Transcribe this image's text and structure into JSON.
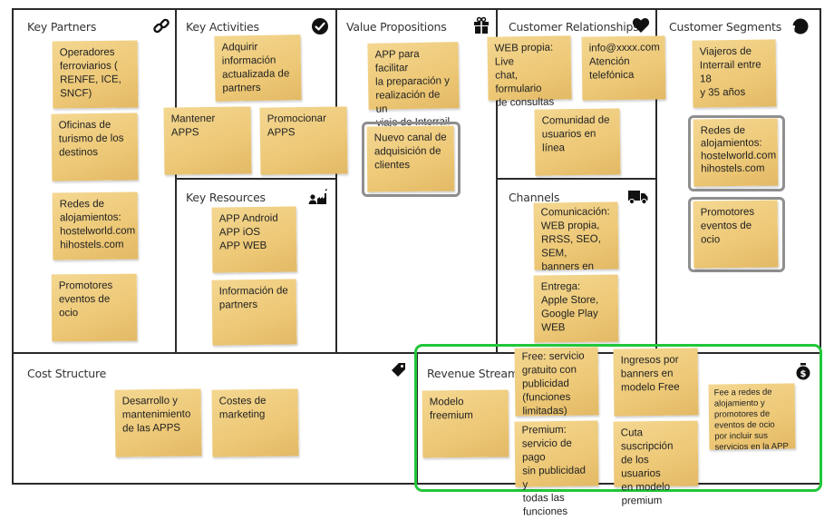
{
  "canvas": {
    "key_partners": {
      "title": "Key Partners",
      "icon": "link-icon",
      "notes": [
        "Operadores\nferroviarios (\nRENFE, ICE,\nSNCF)",
        "Oficinas de\nturismo de los\ndestinos",
        "Redes de\nalojamientos:\nhostelworld.com\nhihostels.com",
        "Promotores\neventos de ocio"
      ]
    },
    "key_activities": {
      "title": "Key Activities",
      "icon": "checkmark-circle-icon",
      "notes": [
        "Adquirir\ninformación\nactualizada de\npartners",
        "Mantener APPS",
        "Promocionar\nAPPS"
      ]
    },
    "key_resources": {
      "title": "Key Resources",
      "icon": "factory-worker-icon",
      "notes": [
        "APP Android\nAPP iOS\nAPP WEB",
        "Información de\npartners"
      ]
    },
    "value_propositions": {
      "title": "Value Propositions",
      "icon": "gift-icon",
      "notes": [
        "APP para facilitar\nla preparación y\nrealización de un\nviaje de Interrail",
        "Nuevo canal de\nadquisición de\nclientes"
      ]
    },
    "customer_relationships": {
      "title": "Customer Relationships",
      "icon": "heart-icon",
      "notes": [
        "WEB propia: Live\nchat, formulario\nde consultas",
        "info@xxxx.com\nAtención\ntelefónica",
        "Comunidad de\nusuarios en línea"
      ]
    },
    "channels": {
      "title": "Channels",
      "icon": "truck-icon",
      "notes": [
        "Comunicación:\nWEB propia,\nRRSS, SEO, SEM,\nbanners en webs\nafines",
        "Entrega:\nApple Store,\nGoogle Play\nWEB"
      ]
    },
    "customer_segments": {
      "title": "Customer Segments",
      "icon": "person-head-icon",
      "notes": [
        "Viajeros de\nInterrail entre 18\ny 35 años",
        "Redes de\nalojamientos:\nhostelworld.com\nhihostels.com",
        "Promotores\neventos de ocio"
      ]
    },
    "cost_structure": {
      "title": "Cost Structure",
      "icon": "price-tag-icon",
      "notes": [
        "Desarrollo y\nmantenimiento\nde las APPS",
        "Costes de\nmarketing"
      ]
    },
    "revenue_streams": {
      "title": "Revenue Streams",
      "icon": "money-bag-icon",
      "notes": [
        "Modelo\nfreemium",
        "Free: servicio\ngratuito con\npublicidad\n(funciones\nlimitadas)",
        "Premium:\nservicio de pago\nsin publicidad y\ntodas las\nfunciones",
        "Ingresos por\nbanners en\nmodelo Free",
        "Cuta suscripción\nde los usuarios\nen modelo\npremium",
        "Fee a redes de\nalojamiento  y\npromotores  de\neventos  de ocio\npor incluir sus\nservicios  en la APP"
      ]
    }
  },
  "colors": {
    "note": "#edc876",
    "border": "#2a2a2a",
    "highlight_gray": "#8f8f8f",
    "highlight_green": "#22c63a"
  }
}
